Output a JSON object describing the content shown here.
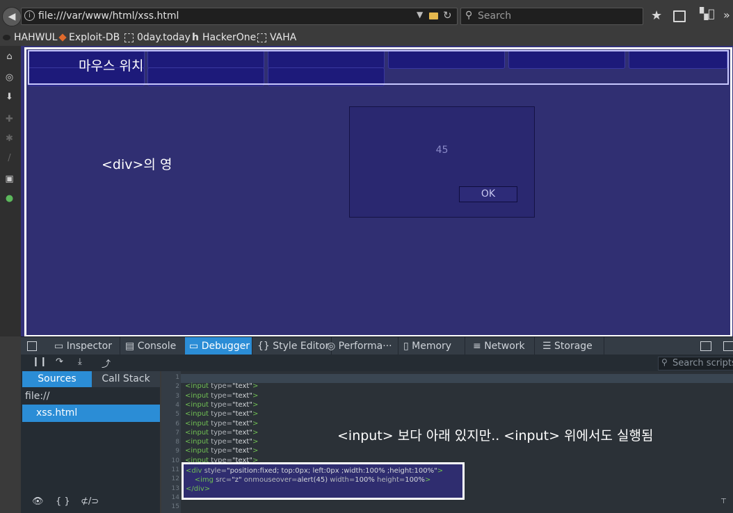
{
  "browser": {
    "url": "file:///var/www/html/xss.html",
    "search_placeholder": "Search",
    "bookmarks": [
      "HAHWUL",
      "Exploit-DB",
      "0day.today",
      "HackerOne",
      "VAHA"
    ]
  },
  "page": {
    "mouse_position_label": "마우스 위치",
    "div_area_label": "<div>의 영",
    "alert": {
      "message": "45",
      "ok_label": "OK"
    }
  },
  "devtools": {
    "tabs": [
      "Inspector",
      "Console",
      "Debugger",
      "{} Style Editor",
      "Performa···",
      "Memory",
      "Network",
      "Storage"
    ],
    "active_tab": "Debugger",
    "search_scripts_placeholder": "Search scripts",
    "sources_tab": "Sources",
    "callstack_tab": "Call Stack",
    "file_origin": "file://",
    "file_name": "xss.html",
    "line_numbers": [
      "1",
      "2",
      "3",
      "4",
      "5",
      "6",
      "7",
      "8",
      "9",
      "10",
      "11",
      "12",
      "13",
      "14",
      "15"
    ],
    "code_lines": [
      "",
      "<input type=\"text\">",
      "<input type=\"text\">",
      "<input type=\"text\">",
      "<input type=\"text\">",
      "<input type=\"text\">",
      "<input type=\"text\">",
      "<input type=\"text\">",
      "<input type=\"text\">",
      "<input type=\"text\">",
      "<div style=\"position:fixed; top:0px; left:0px ;width:100% ;height:100%\">",
      "    <img src=\"z\" onmouseover=alert(45) width=100% height=100%>",
      "</div>",
      "",
      ""
    ],
    "overlay_note": "<input> 보다 아래 있지만.. <input> 위에서도 실행됨"
  }
}
